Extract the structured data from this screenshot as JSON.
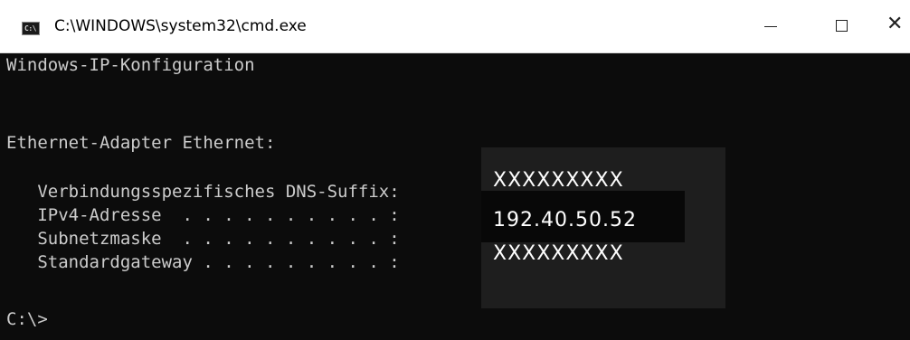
{
  "window": {
    "title": "C:\\WINDOWS\\system32\\cmd.exe",
    "icon_text": "C:\\",
    "icon": "console-window-icon",
    "controls": {
      "minimize_icon": "minimize-icon",
      "maximize_icon": "maximize-icon",
      "close_icon": "close-icon",
      "close_glyph": "✕"
    }
  },
  "console": {
    "lines": {
      "header": "Windows-IP-Konfiguration",
      "adapter": "Ethernet-Adapter Ethernet:",
      "dns_suffix_label": "   Verbindungsspezifisches DNS-Suffix:",
      "ipv4_label": "   IPv4-Adresse  . . . . . . . . . . :",
      "subnet_label": "   Subnetzmaske  . . . . . . . . . . :",
      "gateway_label": "   Standardgateway . . . . . . . . . :",
      "prompt": "C:\\>"
    },
    "values": {
      "dns_suffix": "XXXXXXXXX",
      "ipv4": "192.40.50.52",
      "subnet_and_gateway": "XXXXXXXXX"
    },
    "colors": {
      "background": "#0c0c0c",
      "text": "#cccccc",
      "overlay_text": "#ffffff"
    }
  }
}
